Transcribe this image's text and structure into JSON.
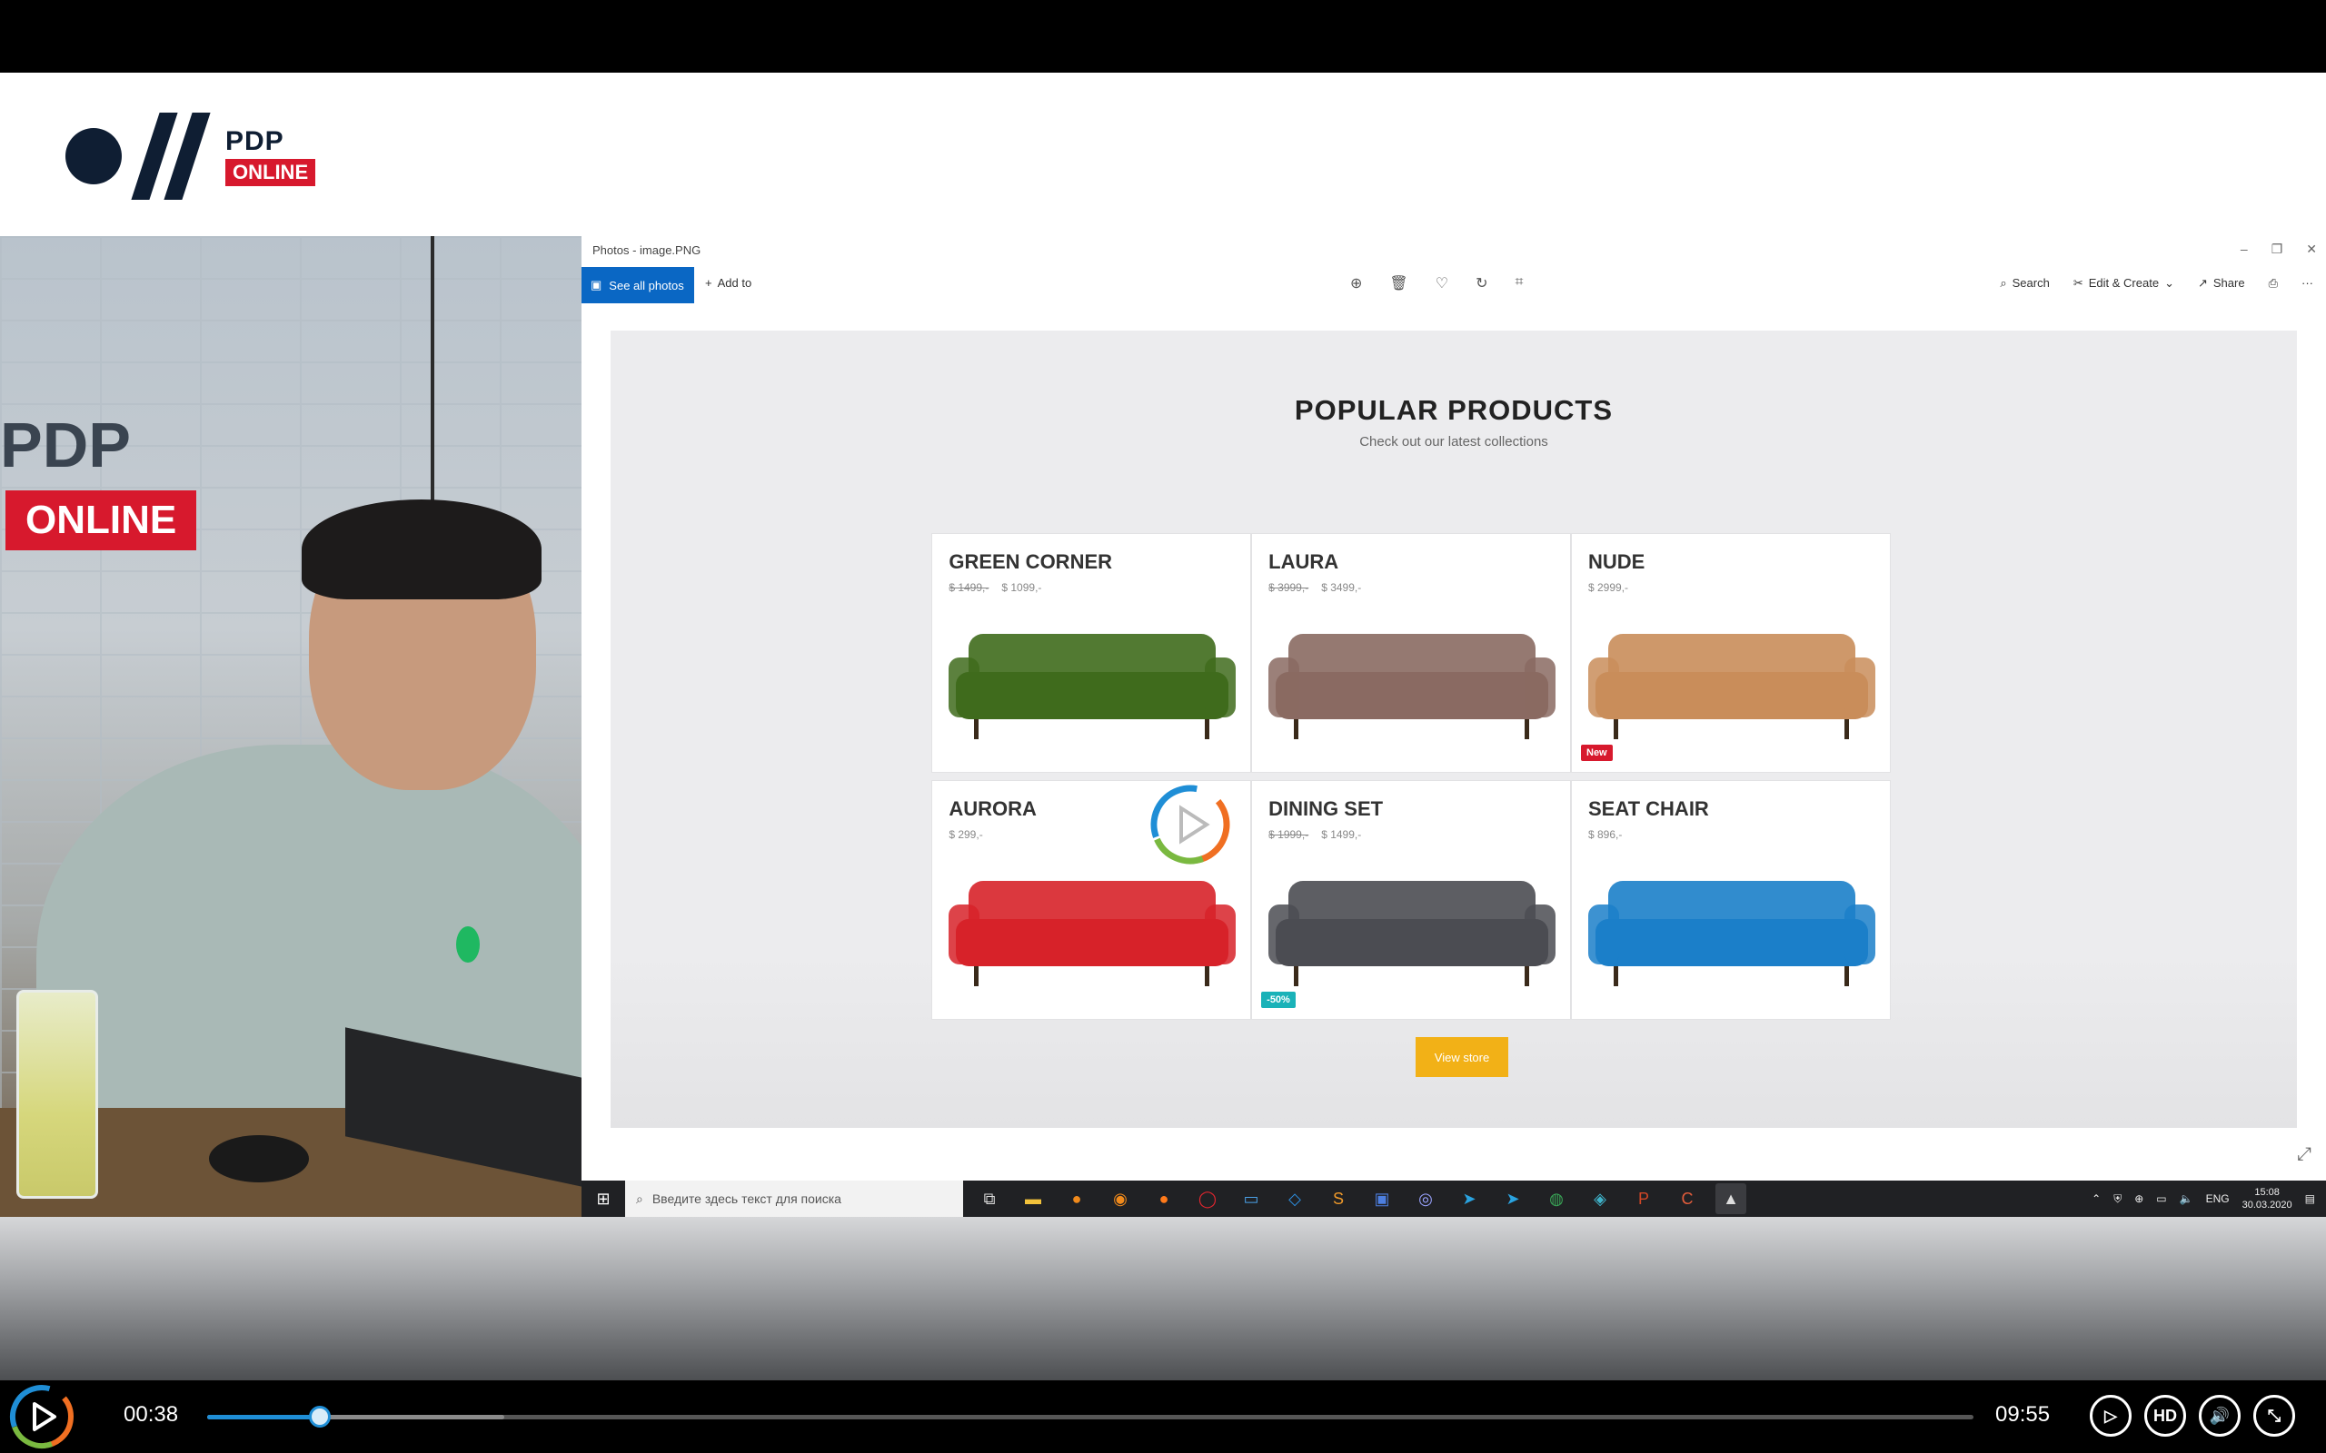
{
  "brand": {
    "name_top": "PDP",
    "name_bottom": "ONLINE"
  },
  "camera": {
    "sign_top": "PDP",
    "sign_bottom": "ONLINE"
  },
  "photos_window": {
    "title": "Photos - image.PNG",
    "controls": [
      "–",
      "❐",
      "✕"
    ],
    "toolbar": {
      "see_all_photos": "See all photos",
      "add_to": "Add to",
      "search": "Search",
      "edit_create": "Edit & Create",
      "share": "Share",
      "more": "···"
    }
  },
  "page": {
    "title": "POPULAR PRODUCTS",
    "subtitle": "Check out our latest collections",
    "view_store": "View store",
    "products": [
      {
        "name": "GREEN CORNER",
        "old_price": "$ 1499,-",
        "price": "$ 1099,-",
        "color": "#3f6b1c",
        "badge": ""
      },
      {
        "name": "LAURA",
        "old_price": "$ 3999,-",
        "price": "$ 3499,-",
        "color": "#8a6a62",
        "badge": ""
      },
      {
        "name": "NUDE",
        "old_price": "",
        "price": "$ 2999,-",
        "color": "#c98d5a",
        "badge": "New"
      },
      {
        "name": "AURORA",
        "old_price": "",
        "price": "$ 299,-",
        "color": "#d72229",
        "badge": ""
      },
      {
        "name": "DINING SET",
        "old_price": "$ 1999,-",
        "price": "$ 1499,-",
        "color": "#4b4c52",
        "badge": "-50%"
      },
      {
        "name": "SEAT CHAIR",
        "old_price": "",
        "price": "$ 896,-",
        "color": "#1b7fc9",
        "badge": ""
      }
    ],
    "badge_colors": {
      "New": "#d7192d",
      "-50%": "#1ab2b8"
    }
  },
  "taskbar": {
    "search_placeholder": "Введите здесь текст для поиска",
    "language": "ENG",
    "time": "15:08",
    "date": "30.03.2020"
  },
  "player": {
    "current_time": "00:38",
    "duration": "09:55",
    "played_fraction": 0.064,
    "buffered_fraction": 0.168,
    "hd_label": "HD"
  }
}
